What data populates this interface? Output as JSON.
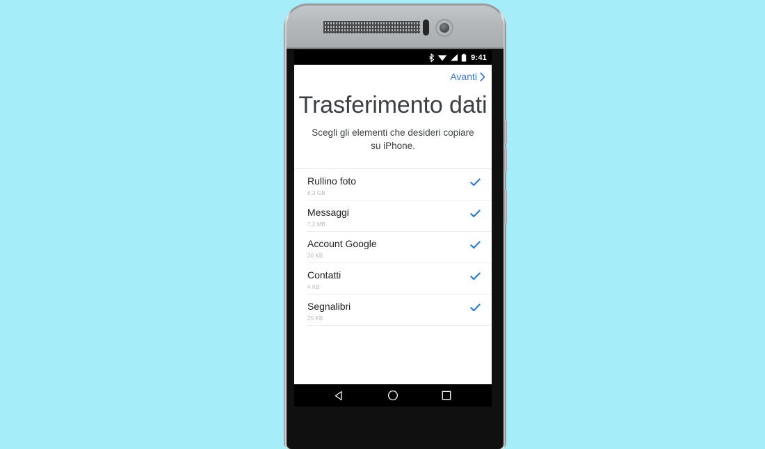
{
  "background_color": "#a6edfa",
  "device": {
    "name": "android-phone",
    "frame_color": "#9a9d9f",
    "body_color": "#101010"
  },
  "status_bar": {
    "icons": [
      "bluetooth-icon",
      "wifi-icon",
      "signal-icon",
      "battery-icon"
    ],
    "clock": "9:41",
    "background": "#000000",
    "foreground": "#ffffff"
  },
  "app": {
    "next_label": "Avanti",
    "next_chevron": "chevron-right-icon",
    "accent_color": "#3b78e7",
    "title": "Trasferimento dati",
    "subtitle": "Scegli gli elementi che desideri copiare su iPhone.",
    "items": [
      {
        "label": "Rullino foto",
        "size": "6,3 GB",
        "checked": true
      },
      {
        "label": "Messaggi",
        "size": "7,2 MB",
        "checked": true
      },
      {
        "label": "Account Google",
        "size": "30 KB",
        "checked": true
      },
      {
        "label": "Contatti",
        "size": "4 KB",
        "checked": true
      },
      {
        "label": "Segnalibri",
        "size": "25 KB",
        "checked": true
      }
    ],
    "check_color": "#1a73e8"
  },
  "nav_bar": {
    "buttons": [
      {
        "name": "back-button",
        "icon": "triangle-left-icon"
      },
      {
        "name": "home-button",
        "icon": "circle-icon"
      },
      {
        "name": "recents-button",
        "icon": "square-icon"
      }
    ],
    "background": "#000000"
  }
}
